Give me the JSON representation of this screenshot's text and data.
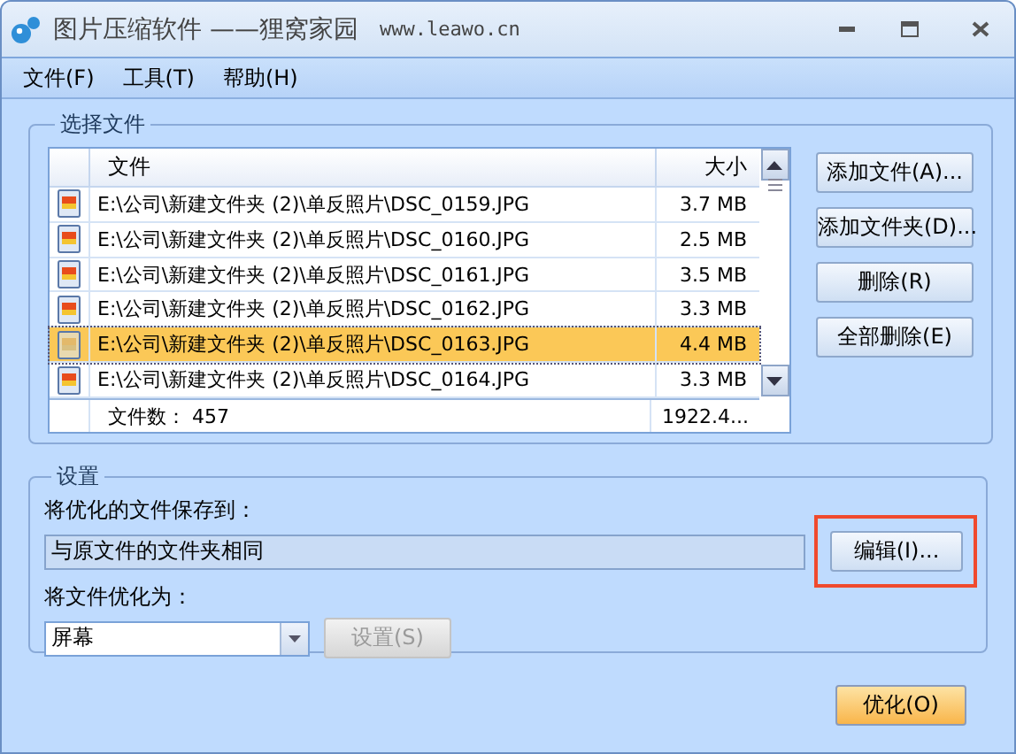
{
  "window": {
    "title": "图片压缩软件 ——狸窝家园",
    "subtitle": "www.leawo.cn"
  },
  "menu": [
    "文件(F)",
    "工具(T)",
    "帮助(H)"
  ],
  "file_group": {
    "title": "选择文件",
    "columns": [
      "文件",
      "大小"
    ],
    "rows": [
      {
        "file": "E:\\公司\\新建文件夹 (2)\\单反照片\\DSC_0159.JPG",
        "size": "3.7 MB",
        "selected": false
      },
      {
        "file": "E:\\公司\\新建文件夹 (2)\\单反照片\\DSC_0160.JPG",
        "size": "2.5 MB",
        "selected": false
      },
      {
        "file": "E:\\公司\\新建文件夹 (2)\\单反照片\\DSC_0161.JPG",
        "size": "3.5 MB",
        "selected": false
      },
      {
        "file": "E:\\公司\\新建文件夹 (2)\\单反照片\\DSC_0162.JPG",
        "size": "3.3 MB",
        "selected": false
      },
      {
        "file": "E:\\公司\\新建文件夹 (2)\\单反照片\\DSC_0163.JPG",
        "size": "4.4 MB",
        "selected": true
      },
      {
        "file": "E:\\公司\\新建文件夹 (2)\\单反照片\\DSC_0164.JPG",
        "size": "3.3 MB",
        "selected": false
      }
    ],
    "footer": {
      "count": "文件数： 457",
      "total": "1922.4..."
    }
  },
  "file_buttons": [
    "添加文件(A)...",
    "添加文件夹(D)...",
    "删除(R)",
    "全部删除(E)"
  ],
  "settings_group": {
    "title": "设置",
    "save_label": "将优化的文件保存到：",
    "save_path": "与原文件的文件夹相同",
    "edit_button": {
      "label": "编辑(I)...",
      "highlighted": true
    },
    "optimize_label": "将文件优化为：",
    "optimize_target": "屏幕",
    "settings_button": {
      "label": "设置(S)",
      "disabled": true
    }
  },
  "optimize_button": "优化(O)"
}
